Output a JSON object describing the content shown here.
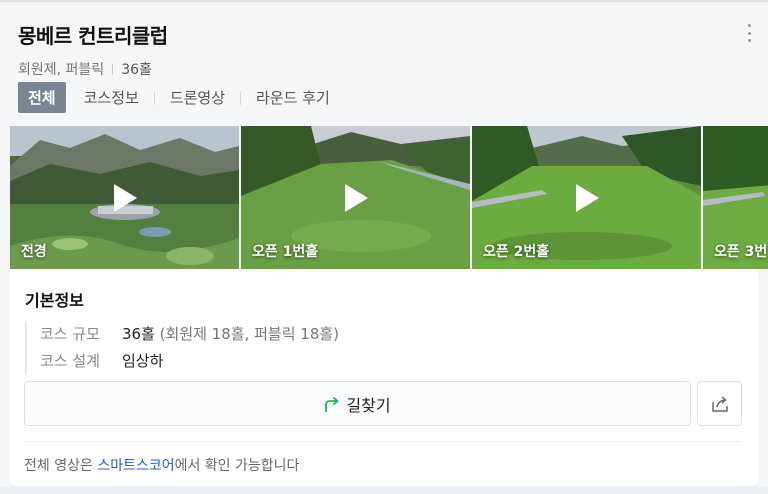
{
  "header": {
    "title": "몽베르 컨트리클럽",
    "type": "회원제, 퍼블릭",
    "holes": "36홀"
  },
  "tabs": [
    {
      "label": "전체",
      "active": true
    },
    {
      "label": "코스정보",
      "active": false
    },
    {
      "label": "드론영상",
      "active": false
    },
    {
      "label": "라운드 후기",
      "active": false
    }
  ],
  "videos": [
    {
      "label": "전경"
    },
    {
      "label": "오픈 1번홀"
    },
    {
      "label": "오픈 2번홀"
    },
    {
      "label": "오픈 3번"
    }
  ],
  "info": {
    "section_title": "기본정보",
    "specs": [
      {
        "key": "코스 규모",
        "value": "36홀",
        "detail": "(회원제 18홀, 퍼블릭 18홀)"
      },
      {
        "key": "코스 설계",
        "value": "임상하",
        "detail": ""
      }
    ],
    "route_label": "길찾기",
    "footer_prefix": "전체 영상은 ",
    "footer_link": "스마트스코어",
    "footer_suffix": "에서 확인 가능합니다"
  },
  "colors": {
    "active_tab_bg": "#7b8591",
    "link": "#1f5fc4",
    "route_arrow": "#1fb85a"
  },
  "icons": [
    "more-vertical-icon",
    "play-icon",
    "route-arrow-icon",
    "share-icon"
  ]
}
